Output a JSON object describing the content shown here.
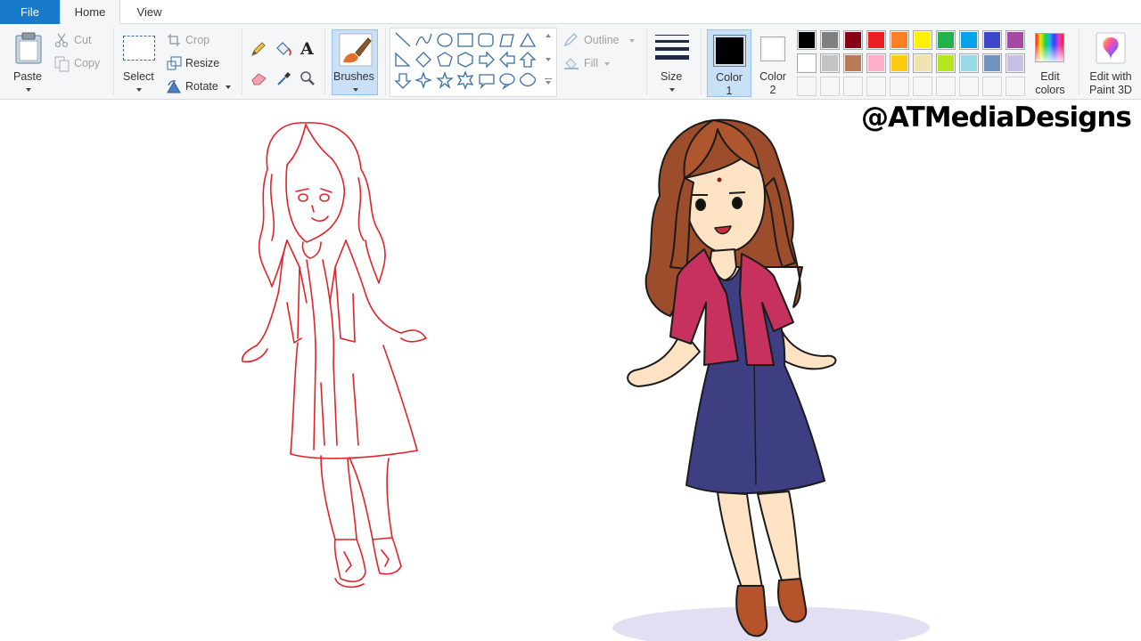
{
  "tabs": {
    "file": "File",
    "home": "Home",
    "view": "View"
  },
  "clipboard": {
    "paste": "Paste",
    "cut": "Cut",
    "copy": "Copy"
  },
  "image": {
    "select": "Select",
    "crop": "Crop",
    "resize": "Resize",
    "rotate": "Rotate"
  },
  "brushes": {
    "label": "Brushes"
  },
  "shapes": {
    "outline": "Outline",
    "fill": "Fill"
  },
  "size": {
    "label": "Size"
  },
  "colors": {
    "color1_label_a": "Color",
    "color1_label_b": "1",
    "color2_label_a": "Color",
    "color2_label_b": "2",
    "edit_a": "Edit",
    "edit_b": "colors",
    "paint3d_a": "Edit with",
    "paint3d_b": "Paint 3D",
    "color1": "#000000",
    "color2": "#ffffff",
    "palette_row1": [
      "#000000",
      "#7f7f7f",
      "#880015",
      "#ed1c24",
      "#ff7f27",
      "#fff200",
      "#22b14c",
      "#00a2e8",
      "#3f48cc",
      "#a349a4"
    ],
    "palette_row2": [
      "#ffffff",
      "#c3c3c3",
      "#b97a57",
      "#ffaec9",
      "#ffc90e",
      "#efe4b0",
      "#b5e61d",
      "#99d9ea",
      "#7092be",
      "#c8bfe7"
    ]
  },
  "canvas": {
    "watermark": "@ATMediaDesigns"
  }
}
